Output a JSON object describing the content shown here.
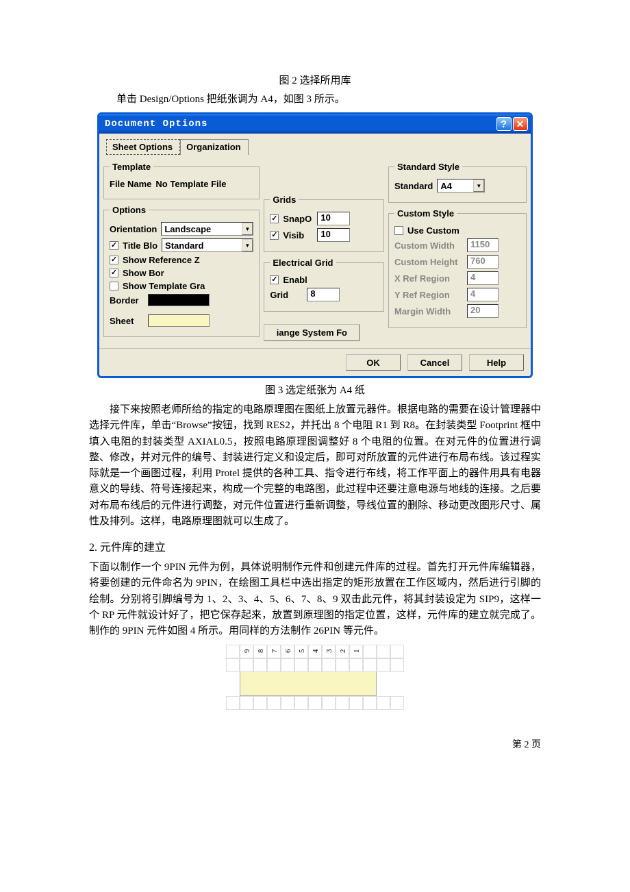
{
  "caption_fig2": "图 2 选择所用库",
  "caption_line2": "单击 Design/Options 把纸张调为 A4，如图 3 所示。",
  "dialog": {
    "title": "Document Options",
    "tabs": {
      "sheet": "Sheet Options",
      "org": "Organization"
    },
    "template_legend": "Template",
    "template_label": "File Name",
    "template_value": "No Template File",
    "options_legend": "Options",
    "orientation_label": "Orientation",
    "orientation_value": "Landscape",
    "titleblock_label": "Title Blo",
    "titleblock_value": "Standard",
    "show_ref": "Show Reference Z",
    "show_bor": "Show Bor",
    "show_tpl": "Show Template Gra",
    "border_label": "Border",
    "sheet_label": "Sheet",
    "grids_legend": "Grids",
    "snap_label": "SnapO",
    "snap_val": "10",
    "visib_label": "Visib",
    "visib_val": "10",
    "egrid_legend": "Electrical Grid",
    "enable_label": "Enabl",
    "grid_label": "Grid",
    "grid_val": "8",
    "change_font_btn": "iange System Fo",
    "std_style_legend": "Standard Style",
    "std_label": "Standard",
    "std_value": "A4",
    "cust_style_legend": "Custom Style",
    "use_custom": "Use Custom",
    "cust_width_label": "Custom Width",
    "cust_width_val": "1150",
    "cust_height_label": "Custom Height",
    "cust_height_val": "760",
    "xref_label": "X Ref Region",
    "xref_val": "4",
    "yref_label": "Y Ref Region",
    "yref_val": "4",
    "margin_label": "Margin Width",
    "margin_val": "20",
    "ok": "OK",
    "cancel": "Cancel",
    "help": "Help"
  },
  "caption_fig3": "图 3 选定纸张为 A4 纸",
  "para1": "接下来按照老师所给的指定的电路原理图在图纸上放置元器件。根据电路的需要在设计管理器中选择元件库，单击“Browse”按钮，找到 RES2，并托出 8 个电阻 R1 到 R8。在封装类型 Footprint 框中填入电阻的封装类型 AXIAL0.5，按照电路原理图调整好 8 个电阻的位置。在对元件的位置进行调整、修改，并对元件的编号、封装进行定义和设定后，即可对所放置的元件进行布局布线。该过程实际就是一个画图过程，利用 Protel 提供的各种工具、指令进行布线，将工作平面上的器件用具有电器意义的导线、符号连接起来，构成一个完整的电路图，此过程中还要注意电源与地线的连接。之后要对布局布线后的元件进行调整，对元件位置进行重新调整，导线位置的删除、移动更改图形尺寸、属性及排列。这样，电路原理图就可以生成了。",
  "sec2_title": "2. 元件库的建立",
  "para2": "下面以制作一个 9PIN 元件为例，具体说明制作元件和创建元件库的过程。首先打开元件库编辑器，将要创建的元件命名为 9PIN，在绘图工具栏中选出指定的矩形放置在工作区域内，然后进行引脚的绘制。分别将引脚编号为 1、2、3、4、5、6、7、8、9 双击此元件，将其封装设定为 SIP9，这样一个 RP 元件就设计好了，把它保存起来，放置到原理图的指定位置，这样，元件库的建立就完成了。制作的 9PIN 元件如图 4 所示。用同样的方法制作 26PIN 等元件。",
  "pins": [
    "9",
    "8",
    "7",
    "6",
    "5",
    "4",
    "3",
    "2",
    "1"
  ],
  "page_num": "第 2 页"
}
